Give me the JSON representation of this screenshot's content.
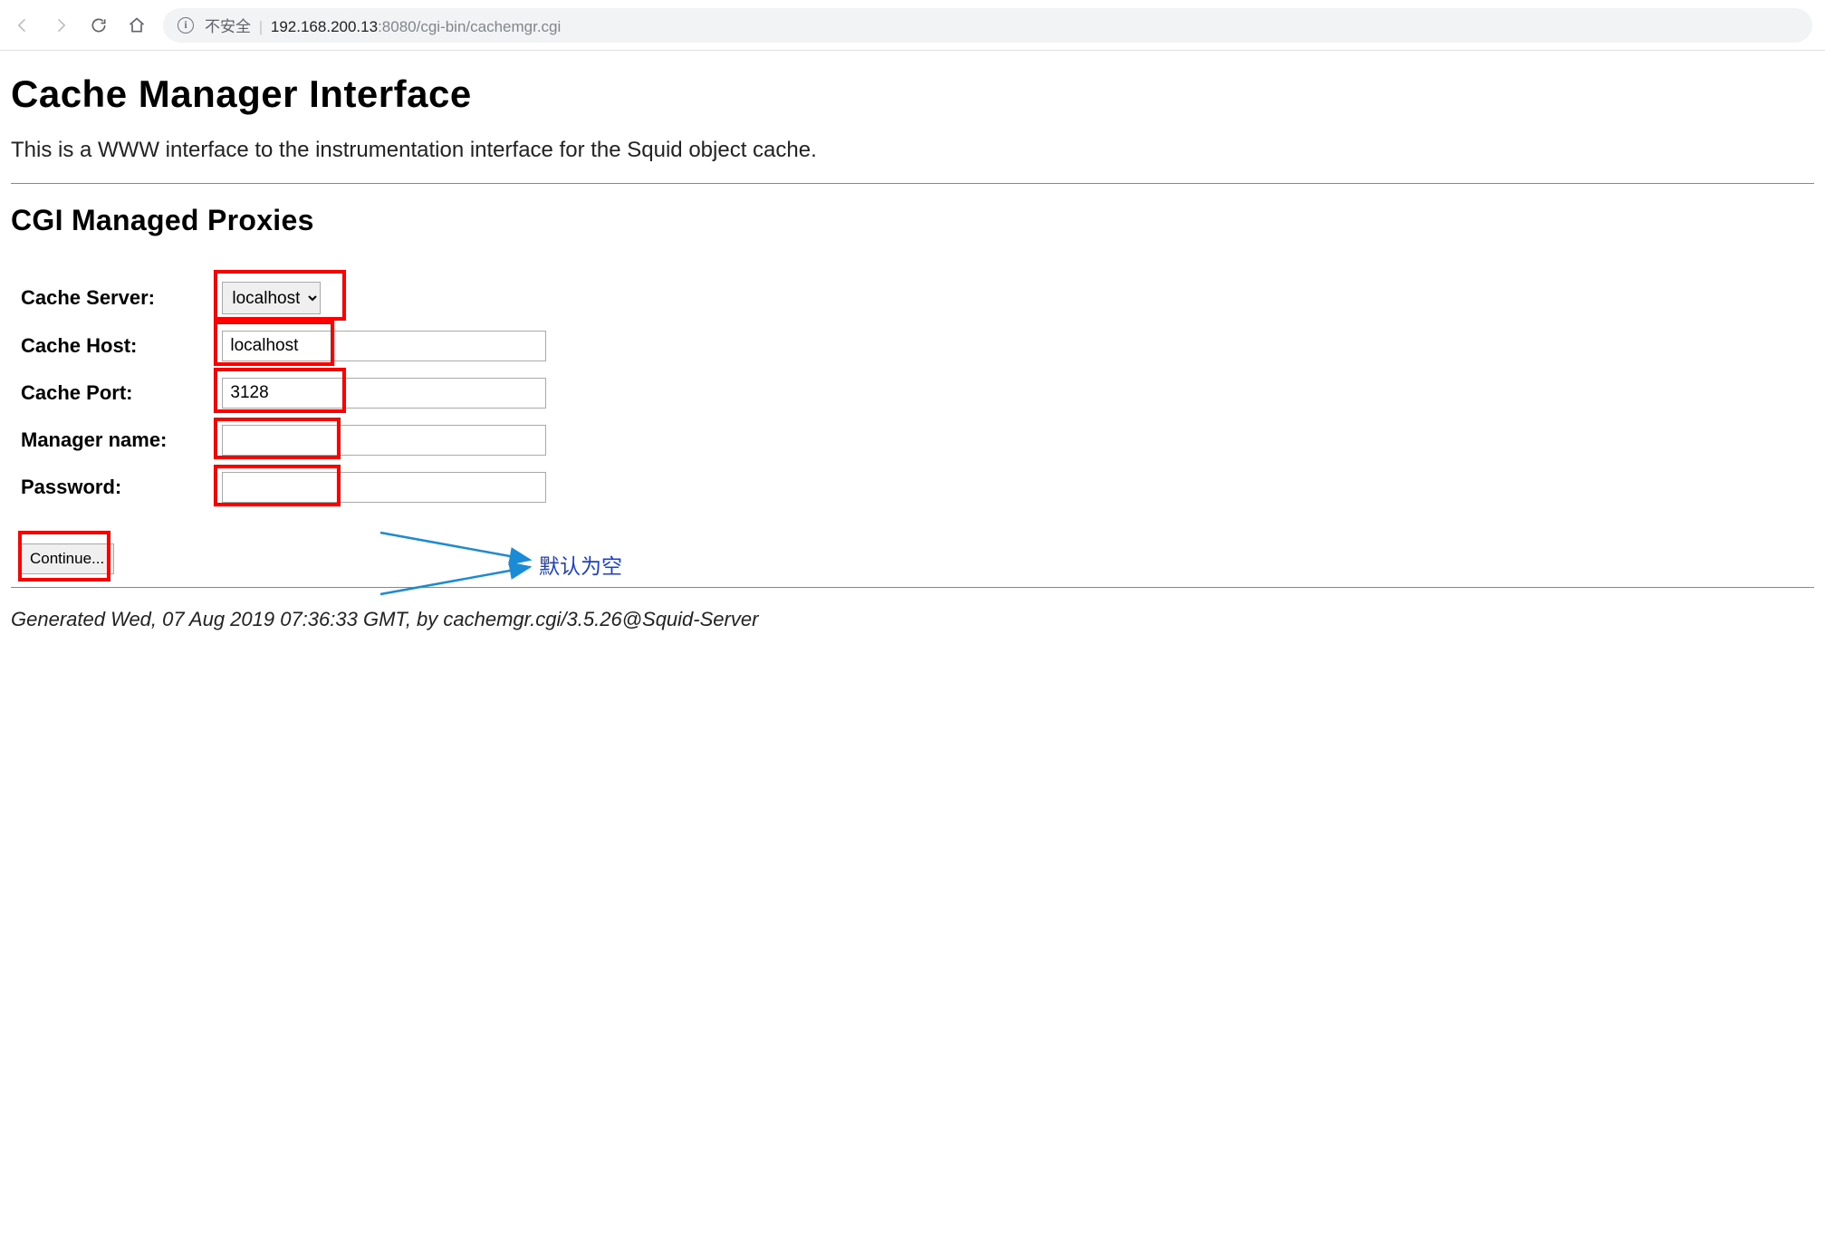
{
  "browser": {
    "insecure_label": "不安全",
    "url_host": "192.168.200.13",
    "url_port": ":8080",
    "url_path": "/cgi-bin/cachemgr.cgi"
  },
  "page": {
    "title": "Cache Manager Interface",
    "subtitle": "This is a WWW interface to the instrumentation interface for the Squid object cache.",
    "section_title": "CGI Managed Proxies"
  },
  "form": {
    "cache_server_label": "Cache Server:",
    "cache_server_value": "localhost",
    "cache_host_label": "Cache Host:",
    "cache_host_value": "localhost",
    "cache_port_label": "Cache Port:",
    "cache_port_value": "3128",
    "manager_name_label": "Manager name:",
    "manager_name_value": "",
    "password_label": "Password:",
    "password_value": "",
    "continue_label": "Continue..."
  },
  "footer": {
    "generated": "Generated Wed, 07 Aug 2019 07:36:33 GMT, by cachemgr.cgi/3.5.26@Squid-Server"
  },
  "annotation": {
    "default_empty": "默认为空"
  }
}
